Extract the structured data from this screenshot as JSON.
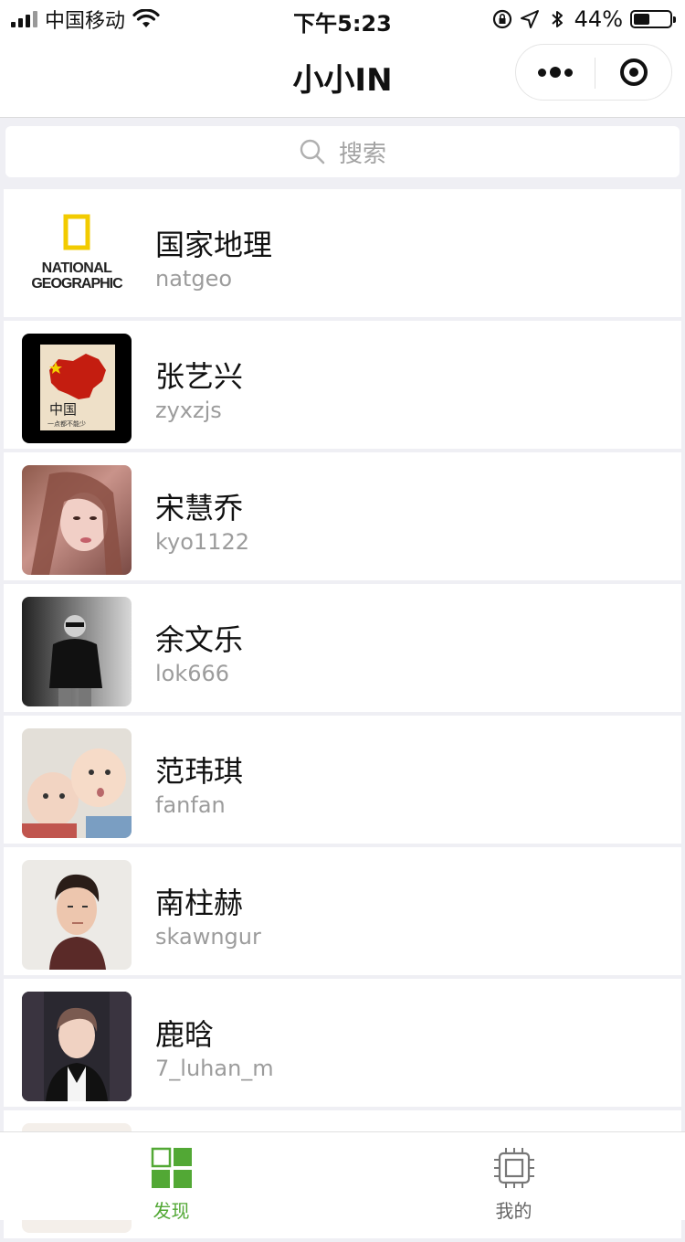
{
  "status_bar": {
    "carrier": "中国移动",
    "time": "下午5:23",
    "battery_percent": "44%",
    "battery_level": 0.44
  },
  "nav": {
    "title": "小小IN"
  },
  "search": {
    "placeholder": "搜索"
  },
  "list": [
    {
      "name": "国家地理",
      "handle": "natgeo",
      "logo_text_1": "NATIONAL",
      "logo_text_2": "GEOGRAPHIC"
    },
    {
      "name": "张艺兴",
      "handle": "zyxzjs",
      "avatar_text_1": "中国",
      "avatar_text_2": "一点都不能少"
    },
    {
      "name": "宋慧乔",
      "handle": "kyo1122"
    },
    {
      "name": "余文乐",
      "handle": "lok666"
    },
    {
      "name": "范玮琪",
      "handle": "fanfan"
    },
    {
      "name": "南柱赫",
      "handle": "skawngur"
    },
    {
      "name": "鹿晗",
      "handle": "7_luhan_m"
    }
  ],
  "tabs": [
    {
      "label": "发现",
      "active": true
    },
    {
      "label": "我的",
      "active": false
    }
  ],
  "colors": {
    "accent_green": "#52a835",
    "background": "#efeff4"
  }
}
